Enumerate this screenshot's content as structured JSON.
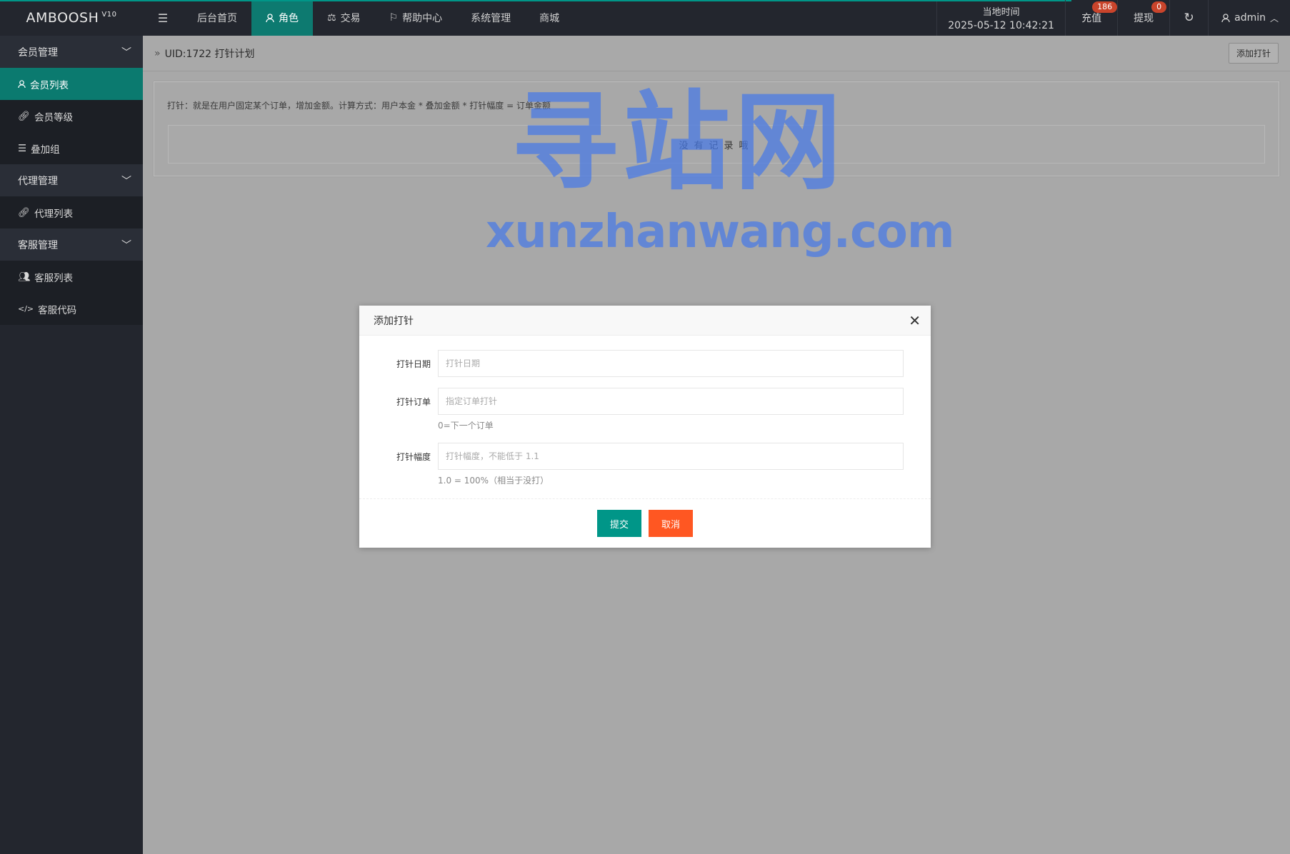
{
  "app": {
    "name": "AMBOOSH",
    "version": "V10"
  },
  "nav": {
    "items": [
      {
        "label": "后台首页",
        "icon": ""
      },
      {
        "label": "角色",
        "icon": "user-icon"
      },
      {
        "label": "交易",
        "icon": "scale-icon"
      },
      {
        "label": "帮助中心",
        "icon": "flag-icon"
      },
      {
        "label": "系统管理",
        "icon": ""
      },
      {
        "label": "商城",
        "icon": ""
      }
    ]
  },
  "topbar": {
    "clock_label": "当地时间",
    "clock_time": "2025-05-12 10:42:21",
    "recharge_label": "充值",
    "recharge_badge": "186",
    "withdraw_label": "提现",
    "withdraw_badge": "0",
    "user_name": "admin"
  },
  "sidebar": {
    "groups": [
      {
        "label": "会员管理",
        "items": [
          {
            "label": "会员列表"
          },
          {
            "label": "会员等级"
          },
          {
            "label": "叠加组"
          }
        ]
      },
      {
        "label": "代理管理",
        "items": [
          {
            "label": "代理列表"
          }
        ]
      },
      {
        "label": "客服管理",
        "items": [
          {
            "label": "客服列表"
          },
          {
            "label": "客服代码"
          }
        ]
      }
    ]
  },
  "main": {
    "breadcrumb": "UID:1722 打针计划",
    "add_button": "添加打针",
    "tip": "打针：就是在用户固定某个订单，增加金额。计算方式：用户本金 * 叠加金额 * 打针幅度 = 订单金额",
    "empty_text": "没有记录哦"
  },
  "watermark": {
    "big": "寻站网",
    "small": "xunzhanwang.com"
  },
  "modal": {
    "title": "添加打针",
    "fields": [
      {
        "label": "打针日期",
        "placeholder": "打针日期",
        "help": ""
      },
      {
        "label": "打针订单",
        "placeholder": "指定订单打针",
        "help": "0=下一个订单"
      },
      {
        "label": "打针幅度",
        "placeholder": "打针幅度，不能低于 1.1",
        "help": "1.0 = 100%（相当于没打）"
      }
    ],
    "submit": "提交",
    "cancel": "取消"
  }
}
